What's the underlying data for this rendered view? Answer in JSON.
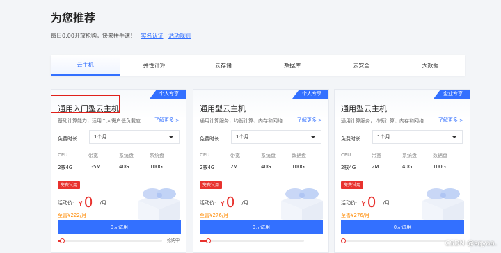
{
  "header": {
    "title": "为您推荐",
    "subtitle": "每日0:00开放抢购，快来拼手速！",
    "links": [
      "实名认证",
      "活动规则"
    ]
  },
  "tabs": [
    {
      "label": "云主机",
      "active": true
    },
    {
      "label": "弹性计算",
      "active": false
    },
    {
      "label": "云存储",
      "active": false
    },
    {
      "label": "数据库",
      "active": false
    },
    {
      "label": "云安全",
      "active": false
    },
    {
      "label": "大数据",
      "active": false
    }
  ],
  "cards": [
    {
      "badge": "个人专享",
      "title": "通用入门型云主机",
      "desc": "基础计算能力，适用个人需户低负载应...",
      "more": "了解更多 >",
      "duration_label": "免费时长",
      "duration_value": "1个月",
      "spec_headers": [
        "CPU",
        "带宽",
        "系统盘",
        "系统盘"
      ],
      "spec_values": [
        "2核4G",
        "1-5M",
        "40G",
        "100G"
      ],
      "free_tag": "免费试用",
      "price_label": "活动价:",
      "currency": "¥",
      "price": "0",
      "unit": "/月",
      "orig_price": "至善¥222/月",
      "button": "0元试用",
      "progress": 0.04,
      "progress_text": "抢购中",
      "highlighted": true
    },
    {
      "badge": "个人专享",
      "title": "通用型云主机",
      "desc": "通用计算服务，均衡计算、内存和网络...",
      "more": "了解更多 >",
      "duration_label": "免费时长",
      "duration_value": "1个月",
      "spec_headers": [
        "CPU",
        "带宽",
        "系统盘",
        "数据盘"
      ],
      "spec_values": [
        "2核4G",
        "2M",
        "40G",
        "100G"
      ],
      "free_tag": "免费试用",
      "price_label": "活动价:",
      "currency": "¥",
      "price": "0",
      "unit": "/月",
      "orig_price": "至善¥276/月",
      "button": "0元试用",
      "progress": 0.08,
      "progress_text": "",
      "highlighted": false
    },
    {
      "badge": "企业专享",
      "title": "通用型云主机",
      "desc": "通用计算服务，均衡计算、内存和网络...",
      "more": "了解更多 >",
      "duration_label": "免费时长",
      "duration_value": "1个月",
      "spec_headers": [
        "CPU",
        "带宽",
        "系统盘",
        "数据盘"
      ],
      "spec_values": [
        "2核4G",
        "2M",
        "40G",
        "100G"
      ],
      "free_tag": "免费试用",
      "price_label": "活动价:",
      "currency": "¥",
      "price": "0",
      "unit": "/月",
      "orig_price": "至善¥276/月",
      "button": "0元试用",
      "progress": 0.0,
      "progress_text": "",
      "highlighted": false
    }
  ],
  "watermark": "CSDN @sqyaa.",
  "colors": {
    "accent": "#3370ff",
    "price": "#e8322e",
    "orig_price": "#ff8a00",
    "highlight_box": "#e0211b"
  }
}
